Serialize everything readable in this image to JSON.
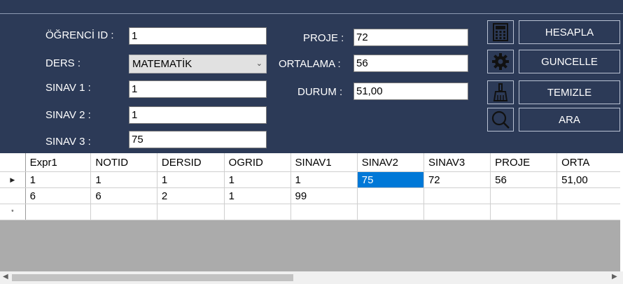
{
  "form": {
    "ogrenci_id_label": "ÖĞRENCİ ID :",
    "ogrenci_id_value": "1",
    "ders_label": "DERS :",
    "ders_value": "MATEMATİK",
    "sinav1_label": "SINAV 1 :",
    "sinav1_value": "1",
    "sinav2_label": "SINAV 2 :",
    "sinav2_value": "1",
    "sinav3_label": "SINAV 3 :",
    "sinav3_value": "75",
    "proje_label": "PROJE :",
    "proje_value": "72",
    "ortalama_label": "ORTALAMA :",
    "ortalama_value": "56",
    "durum_label": "DURUM :",
    "durum_value": "51,00"
  },
  "buttons": {
    "hesapla": "HESAPLA",
    "guncelle": "GUNCELLE",
    "temizle": "TEMIZLE",
    "ara": "ARA"
  },
  "icons": {
    "hesapla": "calculator-icon",
    "guncelle": "gear-icon",
    "temizle": "broom-icon",
    "ara": "search-icon"
  },
  "grid": {
    "columns": [
      "Expr1",
      "NOTID",
      "DERSID",
      "OGRID",
      "SINAV1",
      "SINAV2",
      "SINAV3",
      "PROJE",
      "ORTA"
    ],
    "rows": [
      [
        "1",
        "1",
        "1",
        "1",
        "1",
        "75",
        "72",
        "56",
        "51,00"
      ],
      [
        "6",
        "6",
        "2",
        "1",
        "99",
        "",
        "",
        "",
        ""
      ]
    ],
    "current_row_marker": "▶",
    "new_row_marker": "*",
    "selected_color": "#0078d7"
  },
  "colors": {
    "background": "#2c3a57"
  }
}
